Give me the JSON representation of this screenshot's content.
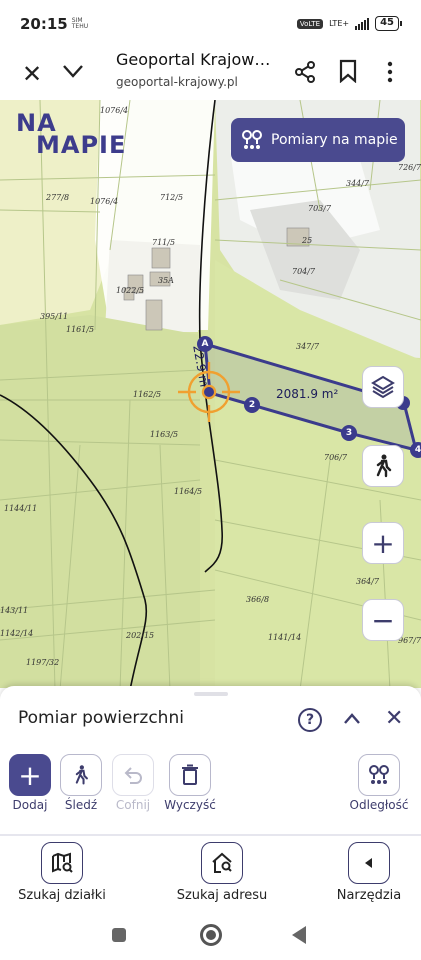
{
  "status_bar": {
    "time": "20:15",
    "sim_label": "SIM TEHU",
    "volte": "VoLTE",
    "network": "LTE+",
    "battery": "45"
  },
  "browser": {
    "title": "Geoportal Krajow…",
    "url": "geoportal-krajowy.pl"
  },
  "map": {
    "brand_line1": "NA",
    "brand_line2": "MAPIE",
    "measure_button_label": "Pomiary na mapie",
    "area_label": "2081.9 m²",
    "length_label": "22.9 m",
    "vertices": [
      "A",
      "2",
      "3",
      "4"
    ],
    "parcels": [
      "1076/4",
      "277/8",
      "1076/4",
      "712/5",
      "344/7",
      "726/7",
      "703/7",
      "711/5",
      "35A",
      "1022/5",
      "25",
      "704/7",
      "395/11",
      "1161/5",
      "347/7",
      "1162/5",
      "1163/5",
      "706/7",
      "1164/5",
      "1144/11",
      "364/7",
      "366/8",
      "143/11",
      "1142/14",
      "202/15",
      "1141/14",
      "967/7",
      "1197/32"
    ],
    "colors": {
      "map_base": "#d7e3a3",
      "parcel_line": "#b9c98a",
      "selection": "#3b3b8c",
      "crosshair": "#f0a030",
      "brand": "#3d3c8c"
    }
  },
  "sheet": {
    "title": "Pomiar powierzchni",
    "help": "?",
    "tools": {
      "add": "Dodaj",
      "track": "Śledź",
      "undo": "Cofnij",
      "clear": "Wyczyść",
      "distance": "Odległość"
    }
  },
  "bottom_nav": {
    "search_parcel": "Szukaj działki",
    "search_address": "Szukaj adresu",
    "tools": "Narzędzia"
  }
}
